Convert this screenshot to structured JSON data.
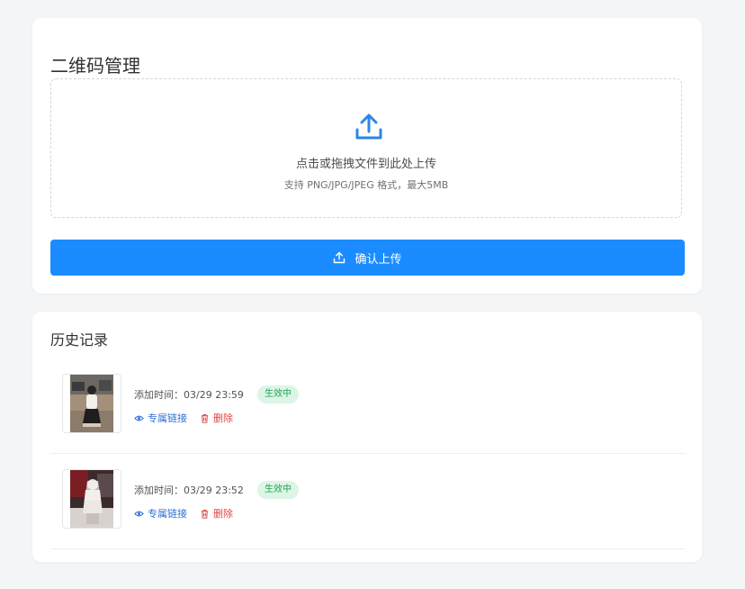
{
  "upload_card": {
    "title": "二维码管理",
    "dropzone_primary": "点击或拖拽文件到此处上传",
    "dropzone_hint": "支持 PNG/JPG/JPEG 格式，最大5MB",
    "confirm_label": "确认上传",
    "upload_icon": "upload-icon"
  },
  "history_card": {
    "title": "历史记录",
    "records": [
      {
        "time": "添加时间：03/29 23:59",
        "status": "生效中",
        "link_label": "专属链接",
        "delete_label": "删除"
      },
      {
        "time": "添加时间：03/29 23:52",
        "status": "生效中",
        "link_label": "专属链接",
        "delete_label": "删除"
      }
    ]
  },
  "colors": {
    "primary": "#1b8cff",
    "status_bg": "#dcf5e6",
    "status_text": "#22a356",
    "link": "#2f6fd6",
    "danger": "#e04545"
  }
}
